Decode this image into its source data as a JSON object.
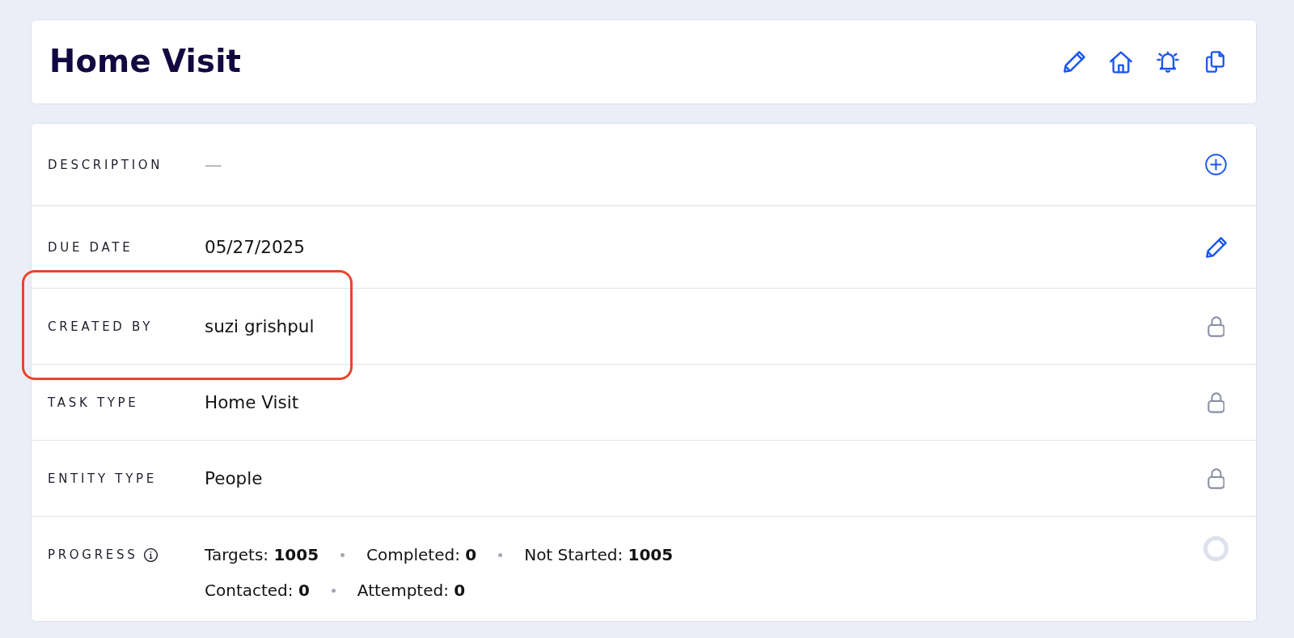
{
  "header": {
    "title": "Home Visit"
  },
  "fields": [
    {
      "label": "DESCRIPTION",
      "value": "—",
      "empty": true,
      "kind": "add",
      "highlighted": false
    },
    {
      "label": "DUE DATE",
      "value": "05/27/2025",
      "empty": false,
      "kind": "edit",
      "highlighted": false
    },
    {
      "label": "CREATED BY",
      "value": "suzi grishpul",
      "empty": false,
      "kind": "locked",
      "highlighted": true
    },
    {
      "label": "TASK TYPE",
      "value": "Home Visit",
      "empty": false,
      "kind": "locked",
      "highlighted": false
    },
    {
      "label": "ENTITY TYPE",
      "value": "People",
      "empty": false,
      "kind": "locked",
      "highlighted": false
    }
  ],
  "progress": {
    "label": "PROGRESS",
    "lines": [
      [
        "Targets: **1005**",
        "Completed: **0**",
        "Not Started: **1005**"
      ],
      [
        "Contacted: **0**",
        "Attempted: **0**"
      ]
    ]
  }
}
